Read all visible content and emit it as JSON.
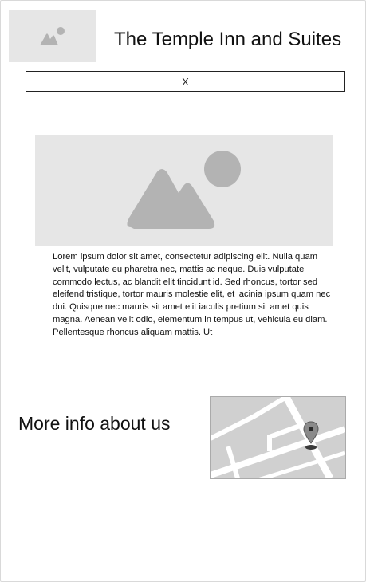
{
  "header": {
    "logo_icon": "image-placeholder-icon",
    "title": "The Temple Inn and Suites"
  },
  "close_bar": {
    "label": "X"
  },
  "hero": {
    "icon": "image-placeholder-icon"
  },
  "content": {
    "paragraph": "Lorem ipsum dolor sit amet, consectetur adipiscing elit. Nulla quam velit, vulputate eu pharetra nec, mattis ac neque. Duis vulputate commodo lectus, ac blandit elit tincidunt id. Sed rhoncus, tortor sed eleifend tristique, tortor mauris molestie elit, et lacinia ipsum quam nec dui. Quisque nec mauris sit amet elit iaculis pretium sit amet quis magna. Aenean velit odio, elementum in tempus ut, vehicula eu diam. Pellentesque rhoncus aliquam mattis. Ut"
  },
  "footer": {
    "more_info": "More info about us",
    "map_icon": "map-pin-icon"
  },
  "colors": {
    "placeholder_bg": "#e6e6e6",
    "placeholder_shape": "#b3b3b3",
    "map_bg": "#d0d0d0",
    "map_roads": "#ffffff",
    "text": "#111111"
  }
}
